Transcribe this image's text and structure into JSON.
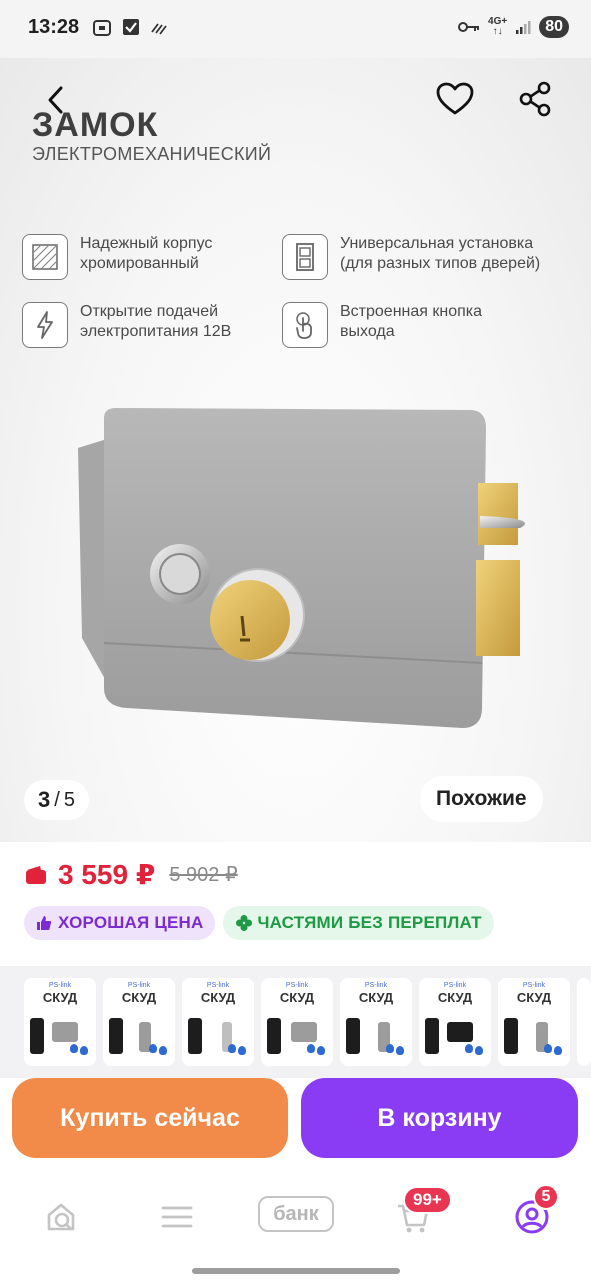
{
  "status_bar": {
    "time": "13:28",
    "network": "4G+",
    "battery": "80",
    "icons": [
      "screenshot-icon",
      "check-box-icon",
      "signal-wave-icon",
      "key-icon",
      "cell-signal-icon"
    ]
  },
  "hero": {
    "title": "ЗАМОК",
    "subtitle": "ЭЛЕКТРОМЕХАНИЧЕСКИЙ",
    "features": [
      {
        "line1": "Надежный корпус",
        "line2": "хромированный",
        "icon": "texture-icon"
      },
      {
        "line1": "Универсальная установка",
        "line2": "(для разных типов дверей)",
        "icon": "door-icon"
      },
      {
        "line1": "Открытие подачей",
        "line2": "электропитания 12В",
        "icon": "lightning-icon"
      },
      {
        "line1": "Встроенная кнопка",
        "line2": "выхода",
        "icon": "touch-icon"
      }
    ],
    "counter_current": "3",
    "counter_separator": "/",
    "counter_total": "5",
    "similar_label": "Похожие"
  },
  "price": {
    "current": "3 559 ₽",
    "old": "5 902 ₽",
    "accent_color": "#e0233b"
  },
  "badges": {
    "good_price": "ХОРОШАЯ ЦЕНА",
    "installments": "ЧАСТЯМИ БЕЗ ПЕРЕПЛАТ"
  },
  "variants": {
    "brand": "PS-link",
    "title": "СКУД",
    "items": [
      "variant-1",
      "variant-2",
      "variant-3",
      "variant-4",
      "variant-5",
      "variant-6",
      "variant-7"
    ]
  },
  "actions": {
    "buy_now": "Купить сейчас",
    "add_to_cart": "В корзину",
    "buy_color": "#f28a4a",
    "cart_color": "#8a3cf4"
  },
  "bottom_nav": {
    "bank_label": "банк",
    "cart_badge": "99+",
    "profile_badge": "5",
    "items": [
      "home-search-icon",
      "menu-icon",
      "bank-icon",
      "cart-icon",
      "profile-icon"
    ]
  }
}
